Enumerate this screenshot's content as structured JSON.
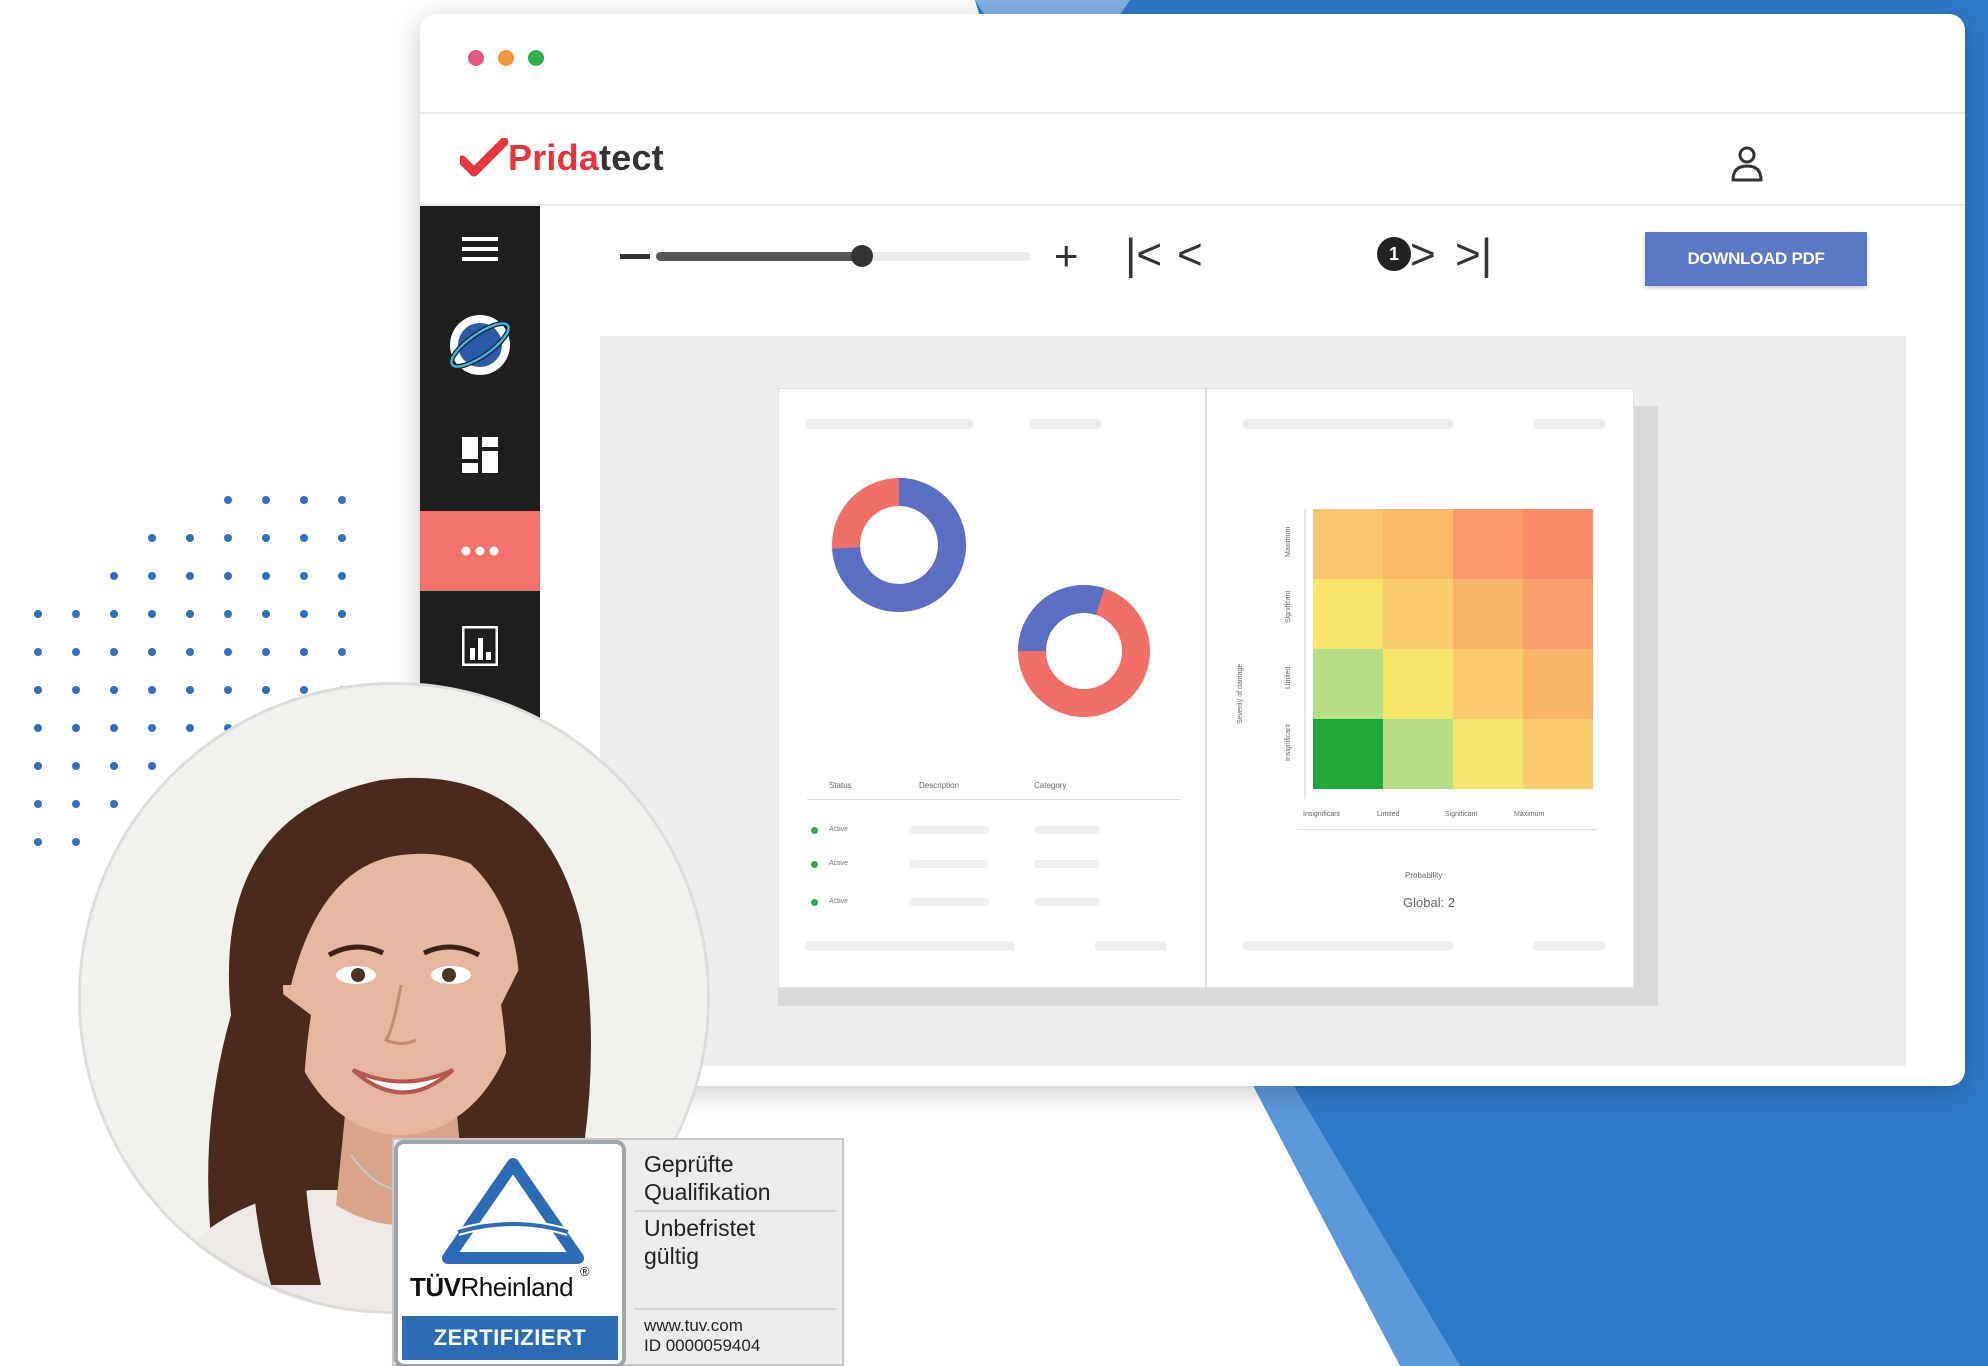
{
  "window": {
    "traffic_colors": [
      "#e05a83",
      "#f29a3a",
      "#2fae4c"
    ]
  },
  "app": {
    "logo_part1": "Prida",
    "logo_part2": "tect",
    "brand_red": "#e8343c",
    "user_icon": "user-icon"
  },
  "sidebar": {
    "items": [
      {
        "icon": "menu-icon",
        "active": false
      },
      {
        "icon": "globe-icon",
        "active": false
      },
      {
        "icon": "dashboard-icon",
        "active": false
      },
      {
        "icon": "more-icon",
        "active": true
      },
      {
        "icon": "bar-chart-icon",
        "active": false
      }
    ],
    "active_color": "#f07268"
  },
  "toolbar": {
    "zoom_minus": "−",
    "zoom_plus": "+",
    "zoom_level": 0.55,
    "first_page": "|<",
    "prev_page": "<",
    "page_number": "1",
    "next_page": ">",
    "last_page": ">|",
    "download_label": "DOWNLOAD PDF",
    "download_color": "#5a79c4"
  },
  "report": {
    "donut_colors": {
      "blue": "#5a6fc4",
      "red": "#f07068"
    },
    "donut1_blue_share": 0.74,
    "donut2_blue_share": 0.3,
    "table_headers": [
      "Status",
      "Description",
      "Category"
    ],
    "table_rows": [
      {
        "status": "Active"
      },
      {
        "status": "Active"
      },
      {
        "status": "Active"
      }
    ],
    "heatmap": {
      "y_title": "Severity of damage",
      "y_labels": [
        "Maximum",
        "Significant",
        "Limited",
        "Insignificant"
      ],
      "x_labels": [
        "Insignificant",
        "Limited",
        "Significant",
        "Maximum"
      ],
      "x_title": "Probability",
      "score": "Global: 2",
      "colors": [
        [
          "#f7c66e",
          "#f9b866",
          "#f99a68",
          "#f88c6c"
        ],
        [
          "#f7e46a",
          "#f8cb6c",
          "#f8b469",
          "#f89f6b"
        ],
        [
          "#b5de86",
          "#f7e46a",
          "#f8cb6c",
          "#f8b469"
        ],
        [
          "#22a83a",
          "#b5de86",
          "#f7e46a",
          "#f8cb6c"
        ]
      ]
    }
  },
  "badge": {
    "brand_t": "TÜV",
    "brand_r": "Rheinland",
    "registered": "®",
    "band": "ZERTIFIZIERT",
    "line1": "Geprüfte",
    "line2": "Qualifikation",
    "line3": "Unbefristet",
    "line4": "gültig",
    "url": "www.tuv.com",
    "id": "ID 0000059404"
  }
}
